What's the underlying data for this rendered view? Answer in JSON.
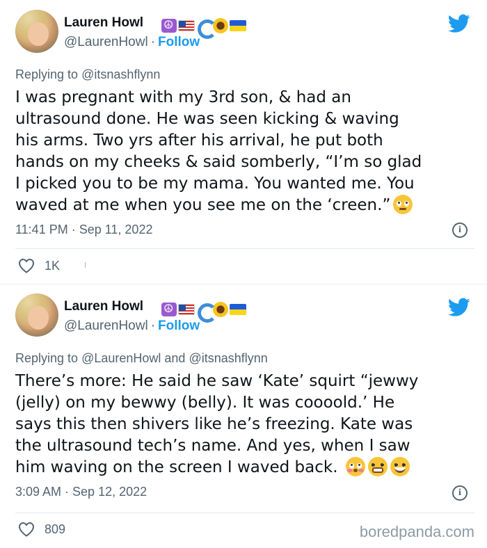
{
  "tweets": [
    {
      "author": {
        "name": "Lauren Howl",
        "handle": "@LaurenHowl",
        "follow_label": "Follow"
      },
      "name_emojis": [
        "peace-symbol",
        "us-flag",
        "water-wave",
        "sunflower",
        "ukraine-flag"
      ],
      "replying_prefix": "Replying to",
      "replying_to": "@itsnashflynn",
      "lines": [
        "I was pregnant with my 3rd son, & had an",
        "ultrasound done. He was seen kicking & waving",
        "his arms. Two yrs after his arrival, he put both",
        "hands on my cheeks & said somberly, “I’m so glad",
        "I picked you to be my mama. You wanted me. You",
        "waved at me when you see me on the ‘creen.”"
      ],
      "trailing_emojis": [
        "face-holding-back-tears"
      ],
      "timestamp": "11:41 PM · Sep 11, 2022",
      "likes": "1K"
    },
    {
      "author": {
        "name": "Lauren Howl",
        "handle": "@LaurenHowl",
        "follow_label": "Follow"
      },
      "name_emojis": [
        "peace-symbol",
        "us-flag",
        "water-wave",
        "sunflower",
        "ukraine-flag"
      ],
      "replying_prefix": "Replying to",
      "replying_to": "@LaurenHowl and @itsnashflynn",
      "lines": [
        "There’s more: He said he saw ‘Kate’ squirt “jewwy",
        "(jelly) on my bewwy (belly). It was coooold.’ He",
        "says this then shivers like he’s freezing. Kate was",
        "the ultrasound tech’s name. And yes, when I saw",
        "him waving on the screen I waved back."
      ],
      "trailing_emojis": [
        "flushed-face",
        "grimacing-face",
        "grinning-face"
      ],
      "timestamp": "3:09 AM · Sep 12, 2022",
      "likes": "809"
    }
  ],
  "watermark": "boredpanda.com",
  "colors": {
    "accent": "#1d9bf0",
    "text": "#0f1419",
    "muted": "#536471",
    "divider": "#e1e8ed"
  },
  "icons": {
    "info": "info-icon",
    "like": "heart-icon",
    "brand": "twitter-bird-icon"
  }
}
